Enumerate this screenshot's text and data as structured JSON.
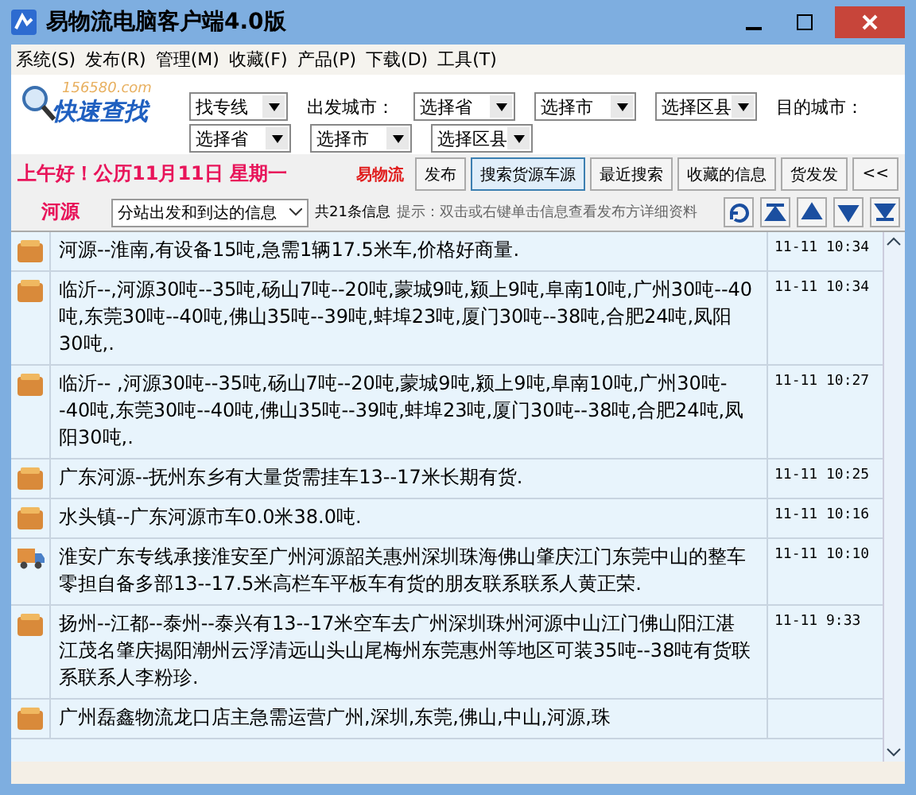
{
  "window": {
    "title": "易物流电脑客户端4.0版"
  },
  "menu": [
    "系统(S)",
    "发布(R)",
    "管理(M)",
    "收藏(F)",
    "产品(P)",
    "下载(D)",
    "工具(T)"
  ],
  "logo": {
    "site": "156580.com",
    "title": "快速查找"
  },
  "search": {
    "mode": "找专线",
    "from_label": "出发城市：",
    "from": [
      "选择省",
      "选择市",
      "选择区县"
    ],
    "to_label": "目的城市：",
    "to": [
      "选择省",
      "选择市",
      "选择区县"
    ]
  },
  "greeting": "上午好！公历11月11日 星期一",
  "brand": "易物流",
  "actions": [
    {
      "label": "发布",
      "selected": false
    },
    {
      "label": "搜索货源车源",
      "selected": true
    },
    {
      "label": "最近搜索",
      "selected": false
    },
    {
      "label": "收藏的信息",
      "selected": false
    },
    {
      "label": "货发发",
      "selected": false
    }
  ],
  "collapse": "<<",
  "city": "河源",
  "filter": "分站出发和到达的信息",
  "count": "共21条信息",
  "hint": "提示：双击或右键单击信息查看发布方详细资料",
  "rows": [
    {
      "kind": "cargo",
      "text": "河源--淮南,有设备15吨,急需1辆17.5米车,价格好商量.",
      "time": "11-11 10:34"
    },
    {
      "kind": "cargo",
      "text": "临沂--,河源30吨--35吨,砀山7吨--20吨,蒙城9吨,颍上9吨,阜南10吨,广州30吨--40吨,东莞30吨--40吨,佛山35吨--39吨,蚌埠23吨,厦门30吨--38吨,合肥24吨,凤阳30吨,.",
      "time": "11-11 10:34"
    },
    {
      "kind": "cargo",
      "text": "临沂-- ,河源30吨--35吨,砀山7吨--20吨,蒙城9吨,颍上9吨,阜南10吨,广州30吨--40吨,东莞30吨--40吨,佛山35吨--39吨,蚌埠23吨,厦门30吨--38吨,合肥24吨,凤阳30吨,.",
      "time": "11-11 10:27"
    },
    {
      "kind": "cargo",
      "text": "广东河源--抚州东乡有大量货需挂车13--17米长期有货.",
      "time": "11-11 10:25"
    },
    {
      "kind": "cargo",
      "text": "水头镇--广东河源市车0.0米38.0吨.",
      "time": "11-11 10:16"
    },
    {
      "kind": "truck",
      "text": "淮安广东专线承接淮安至广州河源韶关惠州深圳珠海佛山肇庆江门东莞中山的整车零担自备多部13--17.5米高栏车平板车有货的朋友联系联系人黄正荣.",
      "time": "11-11 10:10"
    },
    {
      "kind": "cargo",
      "text": "扬州--江都--泰州--泰兴有13--17米空车去广州深圳珠州河源中山江门佛山阳江湛江茂名肇庆揭阳潮州云浮清远山头山尾梅州东莞惠州等地区可装35吨--38吨有货联系联系人李粉珍.",
      "time": "11-11 9:33"
    },
    {
      "kind": "cargo",
      "text": "广州磊鑫物流龙口店主急需运营广州,深圳,东莞,佛山,中山,河源,珠"
    }
  ]
}
